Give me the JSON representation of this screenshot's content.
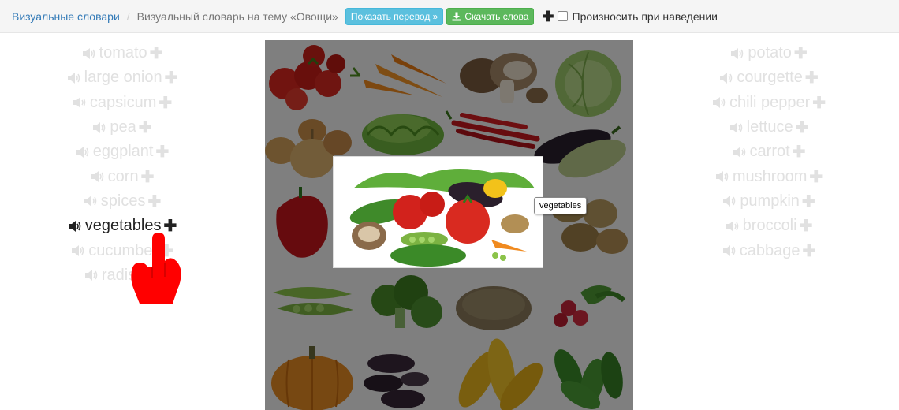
{
  "breadcrumb": {
    "root_label": "Визуальные словари",
    "separator": "/",
    "current_label": "Визуальный словарь на тему «Овощи»"
  },
  "toolbar": {
    "show_translation_label": "Показать перевод »",
    "download_label": "Скачать слова",
    "add_all_symbol": "✚",
    "pronounce_on_hover_label": "Произносить при наведении",
    "pronounce_on_hover_checked": false
  },
  "words_left": [
    {
      "label": "tomato"
    },
    {
      "label": "large onion"
    },
    {
      "label": "capsicum"
    },
    {
      "label": "pea"
    },
    {
      "label": "eggplant"
    },
    {
      "label": "corn"
    },
    {
      "label": "spices"
    },
    {
      "label": "vegetables",
      "active": true
    },
    {
      "label": "cucumber"
    },
    {
      "label": "radish"
    }
  ],
  "words_right": [
    {
      "label": "potato"
    },
    {
      "label": "courgette"
    },
    {
      "label": "chili pepper"
    },
    {
      "label": "lettuce"
    },
    {
      "label": "carrot"
    },
    {
      "label": "mushroom"
    },
    {
      "label": "pumpkin"
    },
    {
      "label": "broccoli"
    },
    {
      "label": "cabbage"
    }
  ],
  "word_plus_symbol": "✚",
  "tooltip": {
    "text": "vegetables"
  },
  "colors": {
    "link": "#337ab7",
    "btn_info": "#5bc0de",
    "btn_success": "#5cb85c",
    "word_inactive": "#e1e1e1",
    "word_active": "#222222",
    "pointer_hand": "#ff0000"
  }
}
